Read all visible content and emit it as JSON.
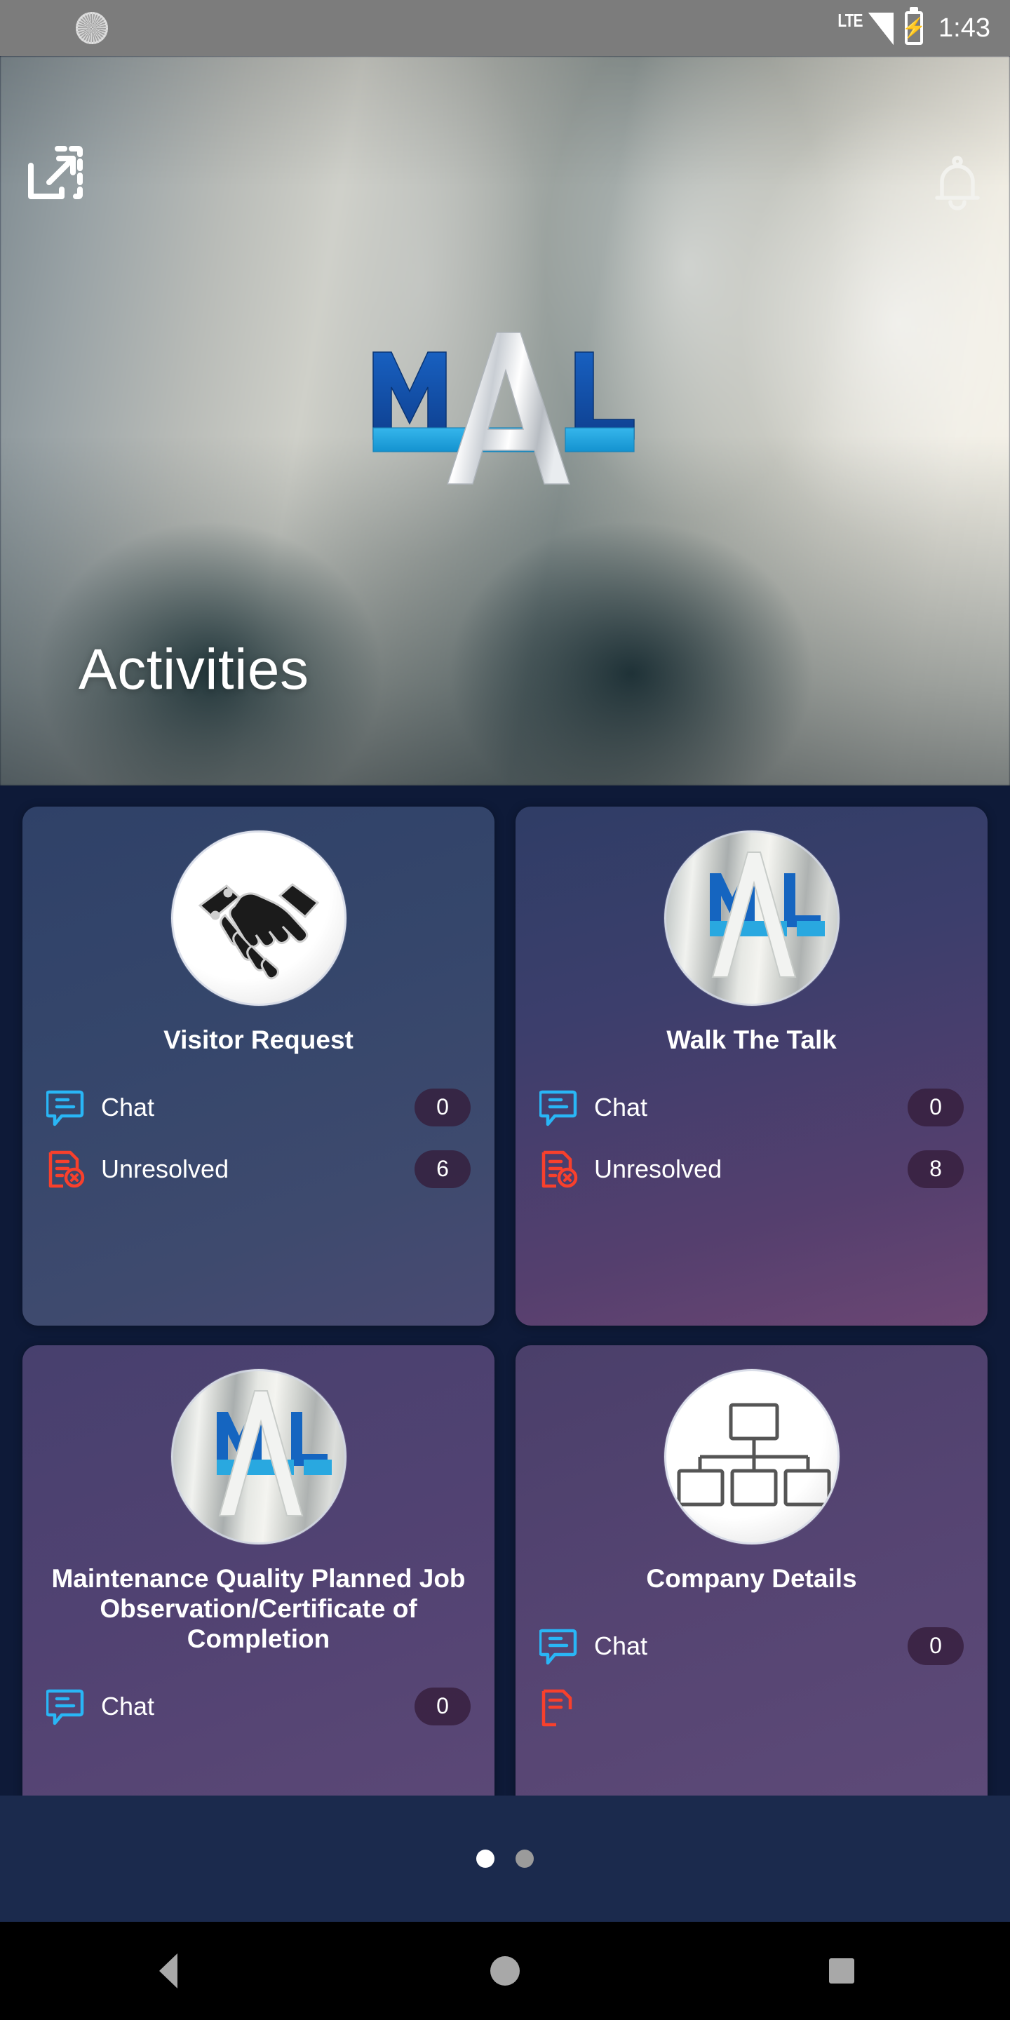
{
  "status_bar": {
    "left_icon": "brightness-sun-icon",
    "network_type": "LTE",
    "signal_icon": "signal-bars-icon",
    "battery_icon": "battery-charging-icon",
    "time": "1:43"
  },
  "header": {
    "expand_icon": "expand-screen-icon",
    "notification_icon": "bell-icon",
    "logo": {
      "name": "mal-logo",
      "letter_m": "M",
      "letter_a": "A",
      "letter_l": "L",
      "blue": "#1255ab",
      "cyan": "#29a8e0",
      "silver": "#e9ecef"
    },
    "title": "Activities"
  },
  "cards": [
    {
      "title": "Visitor Request",
      "avatar_icon": "handshake-icon",
      "avatar_style": "white",
      "stats": [
        {
          "icon": "chat-bubble-icon",
          "label": "Chat",
          "value": "0"
        },
        {
          "icon": "unresolved-document-icon",
          "label": "Unresolved",
          "value": "6"
        }
      ]
    },
    {
      "title": "Walk The Talk",
      "avatar_icon": "mal-logo-icon",
      "avatar_style": "metal",
      "stats": [
        {
          "icon": "chat-bubble-icon",
          "label": "Chat",
          "value": "0"
        },
        {
          "icon": "unresolved-document-icon",
          "label": "Unresolved",
          "value": "8"
        }
      ]
    },
    {
      "title": "Maintenance Quality Planned Job Observation/Certificate of Completion",
      "avatar_icon": "mal-logo-icon",
      "avatar_style": "metal",
      "stats": [
        {
          "icon": "chat-bubble-icon",
          "label": "Chat",
          "value": "0"
        }
      ]
    },
    {
      "title": "Company Details",
      "avatar_icon": "org-chart-icon",
      "avatar_style": "white",
      "stats": [
        {
          "icon": "chat-bubble-icon",
          "label": "Chat",
          "value": "0"
        }
      ]
    }
  ],
  "pagination": {
    "total": 2,
    "active_index": 0
  },
  "navigation_bar": {
    "back": "back-button",
    "home": "home-button",
    "recents": "recents-button"
  },
  "colors": {
    "accent_cyan": "#29b6f6",
    "accent_red": "#f8402c",
    "badge_bg": "#341c3a",
    "page_bg": "#0e1a38",
    "dots_bar_bg": "#1b2a4d"
  }
}
